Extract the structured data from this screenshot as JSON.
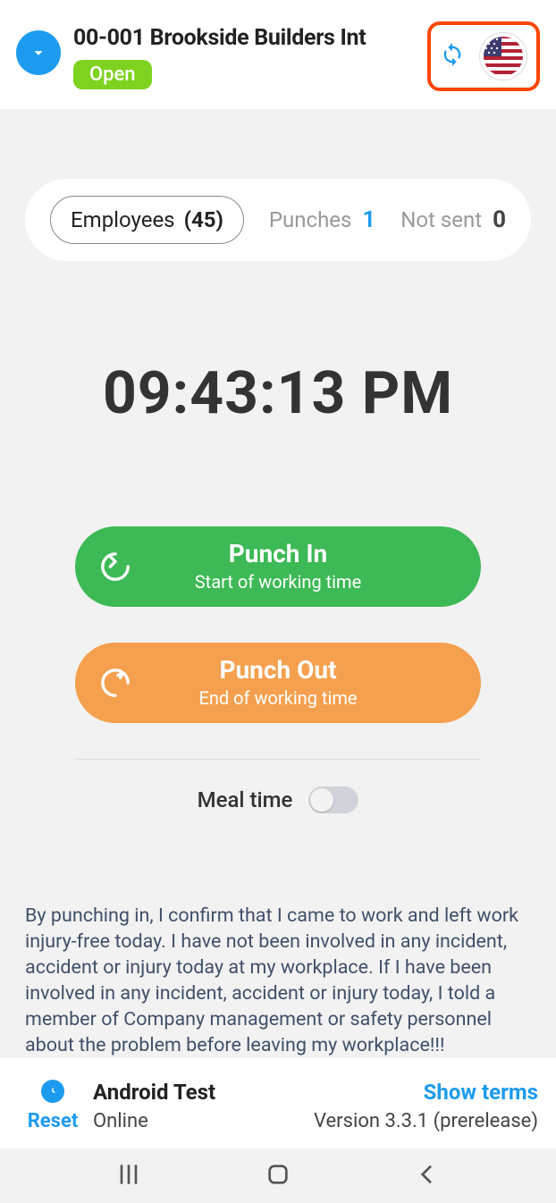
{
  "header": {
    "title": "00-001 Brookside Builders Int",
    "status": "Open"
  },
  "tabs": {
    "employees_label": "Employees",
    "employees_count": "(45)",
    "punches_label": "Punches",
    "punches_count": "1",
    "notsent_label": "Not sent",
    "notsent_count": "0"
  },
  "clock": "09:43:13 PM",
  "buttons": {
    "in_title": "Punch In",
    "in_sub": "Start of working time",
    "out_title": "Punch Out",
    "out_sub": "End of working time"
  },
  "meal": {
    "label": "Meal time"
  },
  "disclaimer": "By punching in, I confirm that I came to work and left work injury-free today. I have not been involved in any incident, accident or injury today at my workplace. If I have been involved in any incident, accident or injury today, I told a member of Company management or safety personnel about the problem before leaving my workplace!!!",
  "footer": {
    "reset": "Reset",
    "device": "Android Test",
    "status": "Online",
    "terms": "Show terms",
    "version": "Version 3.3.1 (prerelease)"
  }
}
